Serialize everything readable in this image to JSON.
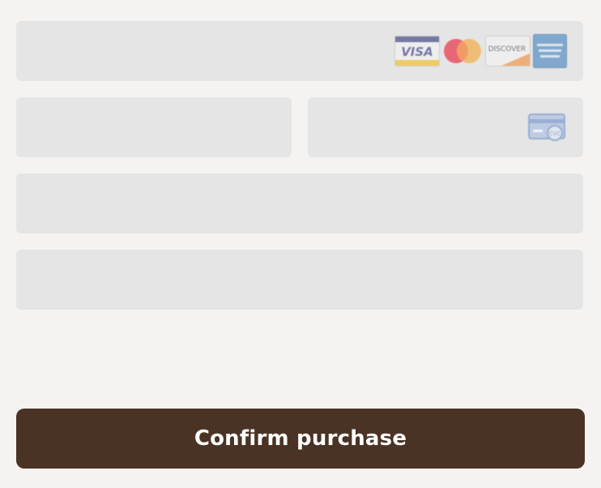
{
  "form": {
    "card_number": {
      "value": "",
      "placeholder": ""
    },
    "expiry": {
      "value": "",
      "placeholder": ""
    },
    "cvc": {
      "value": "",
      "placeholder": ""
    },
    "name": {
      "value": "",
      "placeholder": ""
    },
    "postal": {
      "value": "",
      "placeholder": ""
    }
  },
  "card_brands": {
    "visa": "VISA",
    "discover": "DISCOVER",
    "icons": [
      "visa-card-icon",
      "mastercard-icon",
      "discover-card-icon",
      "amex-card-icon"
    ]
  },
  "cvc_icon": {
    "label": "CVC",
    "icon": "cvc-card-icon"
  },
  "confirm_button": {
    "label": "Confirm purchase"
  },
  "colors": {
    "background": "#f4f3f2",
    "field": "#e5e5e5",
    "button": "#4a3324",
    "button_text": "#ffffff"
  }
}
